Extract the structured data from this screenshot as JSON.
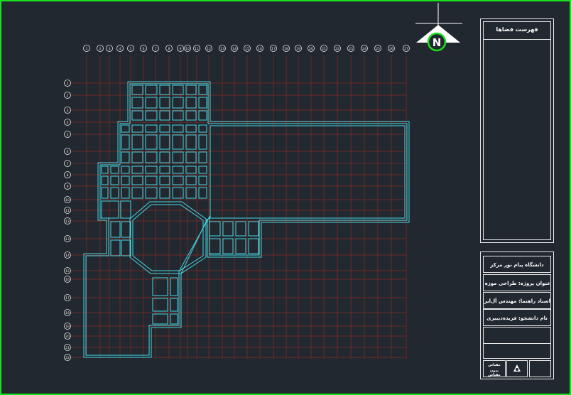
{
  "drawing": {
    "north_label": "N",
    "space_list_title": "فهرست فضاها",
    "university": "دانشگاه پیام نور مرکز",
    "project_title": "عنوان پروژه: طراحی موزه فرش",
    "professor": "استاد راهنما: مهندس آل‌ابراهیم",
    "student": "نام دانشجو: فریده‌دیبیری",
    "scale_label": "مقیاس",
    "scale_value": "بدون مقیاس"
  },
  "colors": {
    "background": "#212830",
    "frame": "#19e01c",
    "walls": "#42d8e4",
    "grid": "#8a2a22",
    "text": "#ffffff"
  },
  "grid_axes": {
    "columns": [
      "1",
      "2",
      "3",
      "4",
      "5",
      "6",
      "7",
      "8",
      "9",
      "10",
      "11",
      "12",
      "13",
      "14",
      "15",
      "16",
      "17",
      "18",
      "19",
      "20",
      "21",
      "22",
      "23",
      "24",
      "25",
      "26",
      "27",
      "28",
      "29",
      "30",
      "31",
      "32",
      "33",
      "34"
    ],
    "rows": [
      "1",
      "2",
      "3",
      "4",
      "5",
      "6",
      "7",
      "8",
      "9",
      "10",
      "11",
      "12",
      "13",
      "14",
      "15",
      "16",
      "17",
      "18",
      "19",
      "20",
      "21",
      "22",
      "23",
      "24",
      "25"
    ]
  }
}
